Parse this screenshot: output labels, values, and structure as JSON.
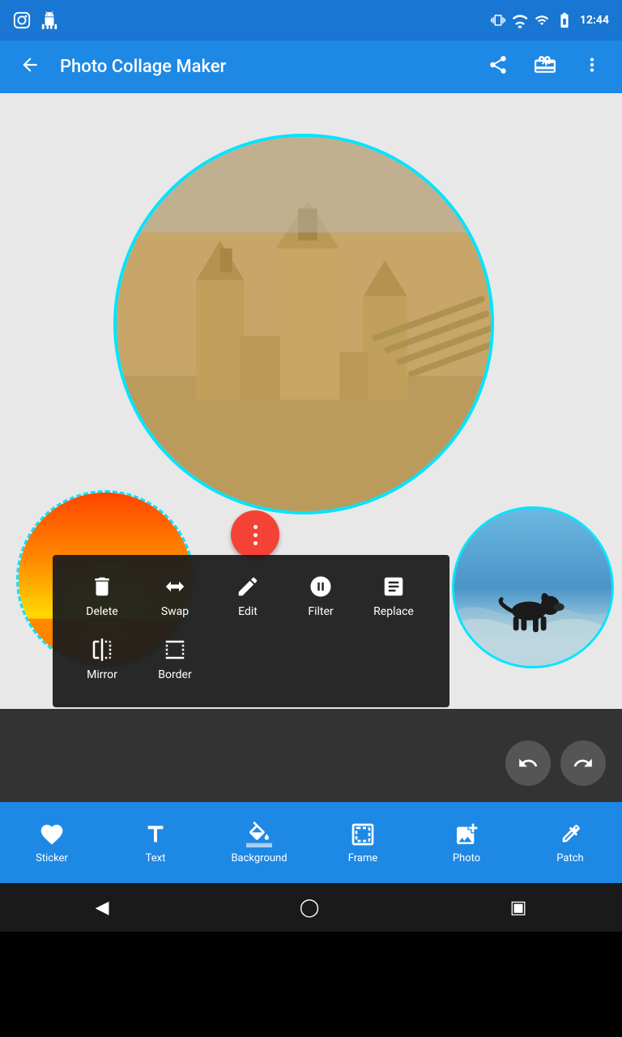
{
  "statusBar": {
    "time": "12:44",
    "icons": [
      "instagram",
      "android",
      "vibrate",
      "wifi",
      "signal",
      "battery"
    ]
  },
  "appBar": {
    "title": "Photo Collage Maker",
    "backLabel": "back",
    "shareLabel": "share",
    "giftLabel": "gift",
    "moreLabel": "more options"
  },
  "contextMenu": {
    "items": [
      {
        "id": "delete",
        "label": "Delete",
        "icon": "trash"
      },
      {
        "id": "swap",
        "label": "Swap",
        "icon": "swap"
      },
      {
        "id": "edit",
        "label": "Edit",
        "icon": "pencil"
      },
      {
        "id": "filter",
        "label": "Filter",
        "icon": "filter"
      },
      {
        "id": "replace",
        "label": "Replace",
        "icon": "replace"
      },
      {
        "id": "mirror",
        "label": "Mirror",
        "icon": "mirror"
      },
      {
        "id": "border",
        "label": "Border",
        "icon": "border"
      }
    ]
  },
  "bottomToolbar": {
    "items": [
      {
        "id": "sticker",
        "label": "Sticker",
        "icon": "heart"
      },
      {
        "id": "text",
        "label": "Text",
        "icon": "text"
      },
      {
        "id": "background",
        "label": "Background",
        "icon": "background"
      },
      {
        "id": "frame",
        "label": "Frame",
        "icon": "frame"
      },
      {
        "id": "photo",
        "label": "Photo",
        "icon": "photo"
      },
      {
        "id": "patch",
        "label": "Patch",
        "icon": "patch"
      }
    ]
  },
  "colors": {
    "primaryBlue": "#1E88E5",
    "accentCyan": "#00E5FF",
    "fabRed": "#F44336",
    "darkBg": "#333333",
    "navBg": "#1a1a1a"
  }
}
